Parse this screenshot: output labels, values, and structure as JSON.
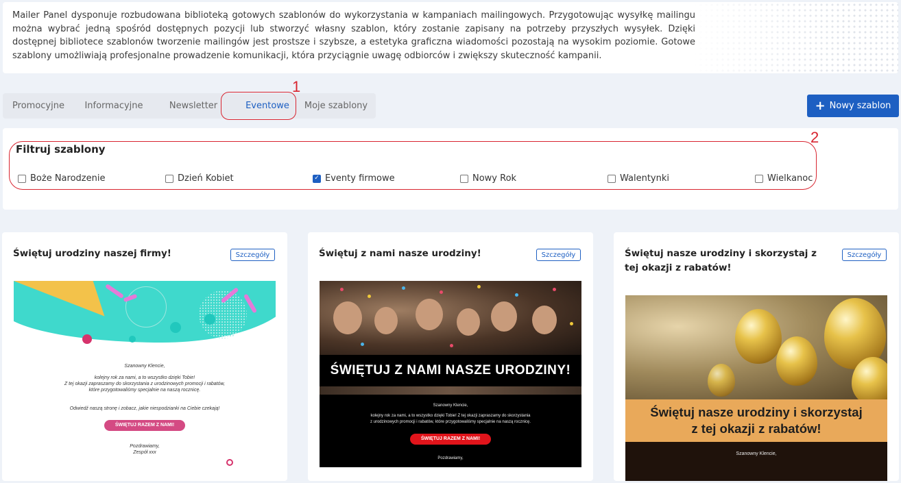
{
  "intro": {
    "text": "Mailer Panel dysponuje rozbudowana biblioteką gotowych szablonów do wykorzystania w kampaniach mailingowych. Przygotowując wysyłkę mailingu można wybrać jedną spośród dostępnych pozycji lub stworzyć własny szablon, który zostanie zapisany na potrzeby przyszłych wysyłek. Dzięki dostępnej bibliotece szablonów tworzenie mailingów jest prostsze i szybsze, a estetyka graficzna wiadomości pozostają na wysokim poziomie. Gotowe szablony umożliwiają profesjonalne prowadzenie komunikacji, która przyciągnie uwagę odbiorców i zwiększy skuteczność kampanii."
  },
  "tabs": [
    {
      "label": "Promocyjne"
    },
    {
      "label": "Informacyjne"
    },
    {
      "label": "Newsletter"
    },
    {
      "label": "Eventowe",
      "active": true
    },
    {
      "label": "Moje szablony"
    }
  ],
  "annotations": {
    "one": "1",
    "two": "2"
  },
  "new_button": {
    "label": "Nowy szablon",
    "icon": "plus-icon"
  },
  "filter": {
    "title": "Filtruj szablony",
    "options": [
      {
        "label": "Boże Narodzenie",
        "checked": false
      },
      {
        "label": "Dzień Kobiet",
        "checked": false
      },
      {
        "label": "Eventy firmowe",
        "checked": true
      },
      {
        "label": "Nowy Rok",
        "checked": false
      },
      {
        "label": "Walentynki",
        "checked": false
      },
      {
        "label": "Wielkanoc",
        "checked": false
      }
    ]
  },
  "cards": [
    {
      "title": "Świętuj urodziny naszej firmy!",
      "details_label": "Szczegóły",
      "preview": {
        "greeting": "Szanowny Klencie,",
        "line1": "kolejny rok za nami, a to wszystko dzięki Tobie!",
        "line2": "Z tej okazji zapraszamy do skorzystania z urodzinowych promocji i rabatów,",
        "line3": "które przygotowaliśmy specjalnie na naszą rocznicę.",
        "line4": "Odwiedź naszą stronę i zobacz, jakie niespodzianki na Ciebie czekają!",
        "button": "ŚWIĘTUJ RAZEM Z NAMI!",
        "sign1": "Pozdrawiamy,",
        "sign2": "Zespół xxx"
      }
    },
    {
      "title": "Świętuj z nami nasze urodziny!",
      "details_label": "Szczegóły",
      "preview": {
        "headline": "ŚWIĘTUJ Z NAMI NASZE URODZINY!",
        "greeting": "Szanowny Klencie,",
        "line1": "kolejny rok za nami, a to wszystko dzięki Tobie! Z tej okazji zapraszamy do skorzystania",
        "line2": "z urodzinowych promocji i rabatów, które przygotowaliśmy specjalnie na naszą rocznicę.",
        "button": "ŚWIĘTUJ RAZEM Z NAMI!",
        "sign1": "Pozdrawiamy,"
      }
    },
    {
      "title": "Świętuj nasze urodziny i skorzystaj z tej okazji z rabatów!",
      "details_label": "Szczegóły",
      "preview": {
        "headline1": "Świętuj nasze urodziny i skorzystaj",
        "headline2": "z tej okazji z rabatów!",
        "greeting": "Szanowny Klencie,"
      }
    }
  ]
}
